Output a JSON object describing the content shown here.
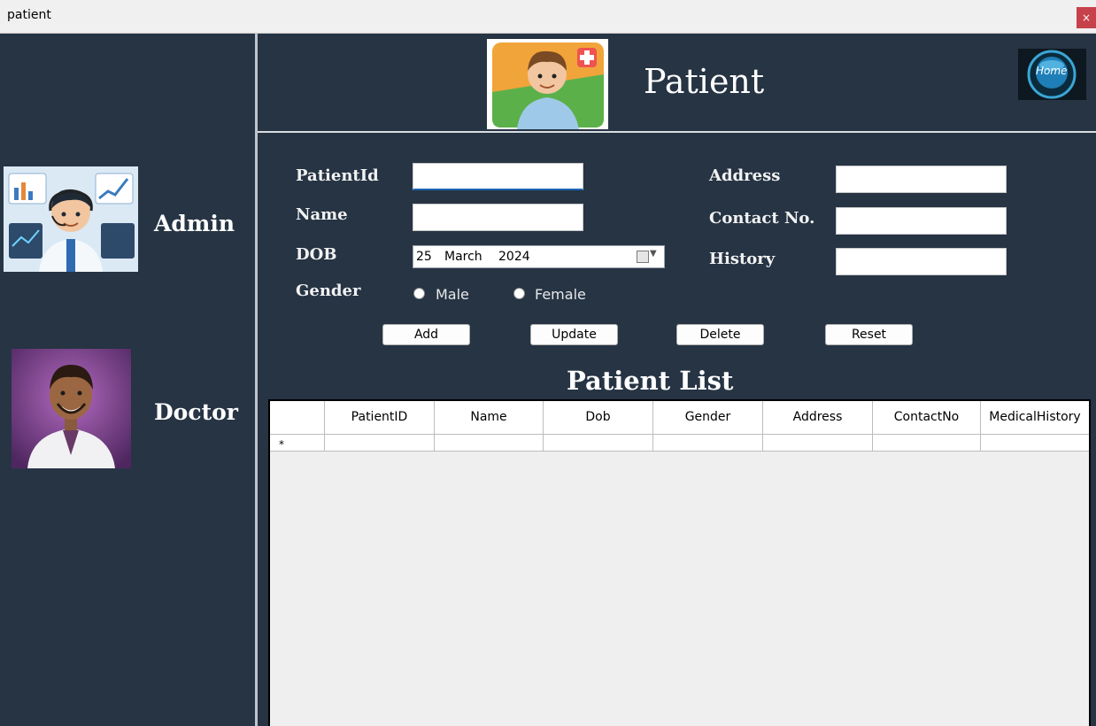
{
  "window": {
    "title": "patient",
    "close_glyph": "×"
  },
  "sidebar": {
    "items": [
      {
        "label": "Admin",
        "icon": "admin-avatar"
      },
      {
        "label": "Doctor",
        "icon": "doctor-avatar"
      }
    ]
  },
  "header": {
    "title": "Patient",
    "home_label": "Home"
  },
  "form": {
    "patient_id_label": "PatientId",
    "name_label": "Name",
    "dob_label": "DOB",
    "gender_label": "Gender",
    "address_label": "Address",
    "contact_label": "Contact No.",
    "history_label": "History",
    "patient_id_value": "",
    "name_value": "",
    "address_value": "",
    "contact_value": "",
    "history_value": "",
    "dob": {
      "day": "25",
      "month": "March",
      "year": "2024"
    },
    "gender_options": [
      "Male",
      "Female"
    ]
  },
  "actions": {
    "add": "Add",
    "update": "Update",
    "delete": "Delete",
    "reset": "Reset"
  },
  "list": {
    "title": "Patient List",
    "columns": [
      "PatientID",
      "Name",
      "Dob",
      "Gender",
      "Address",
      "ContactNo",
      "MedicalHistory"
    ],
    "new_row_marker": "*"
  },
  "colors": {
    "background": "#263444",
    "accent_focus": "#1e63b6",
    "close_red": "#c7414b"
  }
}
